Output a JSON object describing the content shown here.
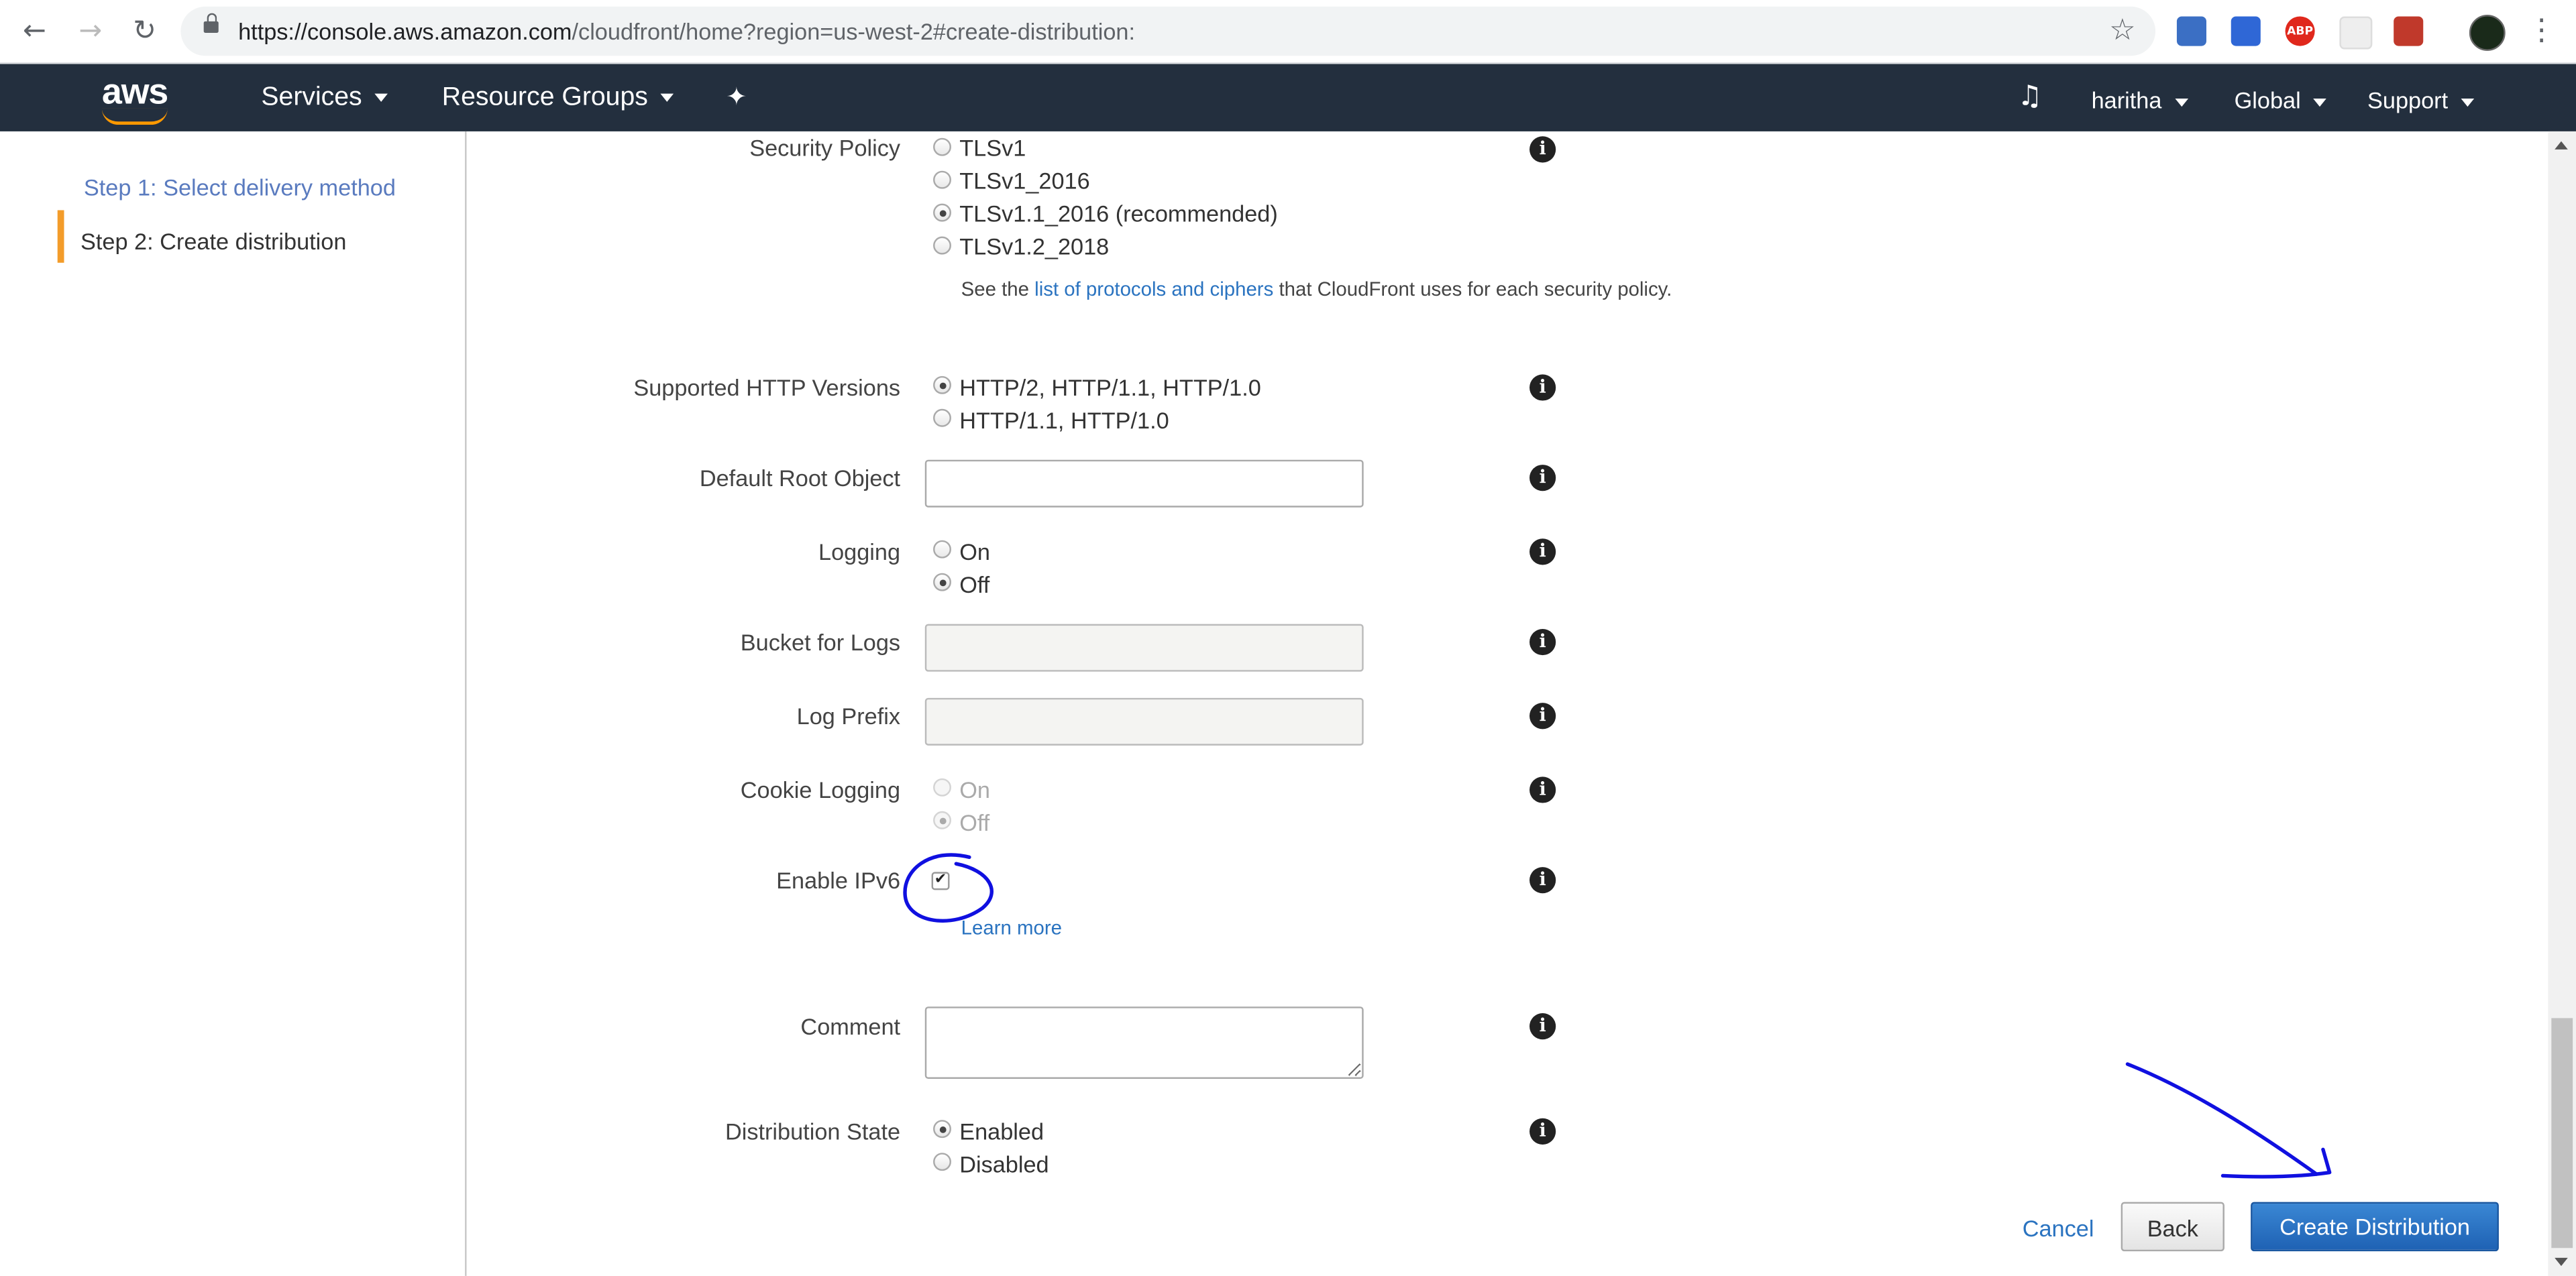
{
  "browser": {
    "url_host": "https://console.aws.amazon.com",
    "url_path": "/cloudfront/home?region=us-west-2#create-distribution:",
    "abp_label": "ABP"
  },
  "header": {
    "logo": "aws",
    "services": "Services",
    "resource_groups": "Resource Groups",
    "user": "haritha",
    "region": "Global",
    "support": "Support"
  },
  "sidebar": {
    "steps": [
      {
        "label": "Step 1: Select delivery method"
      },
      {
        "label": "Step 2: Create distribution"
      }
    ]
  },
  "form": {
    "security_policy": {
      "label": "Security Policy",
      "options": [
        "TLSv1",
        "TLSv1_2016",
        "TLSv1.1_2016 (recommended)",
        "TLSv1.2_2018"
      ],
      "selected": "TLSv1.1_2016 (recommended)",
      "help_prefix": "See the",
      "help_link": "list of protocols and ciphers",
      "help_suffix": "that CloudFront uses for each security policy."
    },
    "http_versions": {
      "label": "Supported HTTP Versions",
      "options": [
        "HTTP/2, HTTP/1.1, HTTP/1.0",
        "HTTP/1.1, HTTP/1.0"
      ],
      "selected": "HTTP/2, HTTP/1.1, HTTP/1.0"
    },
    "default_root_object": {
      "label": "Default Root Object",
      "value": ""
    },
    "logging": {
      "label": "Logging",
      "options": [
        "On",
        "Off"
      ],
      "selected": "Off"
    },
    "bucket_for_logs": {
      "label": "Bucket for Logs",
      "value": ""
    },
    "log_prefix": {
      "label": "Log Prefix",
      "value": ""
    },
    "cookie_logging": {
      "label": "Cookie Logging",
      "options": [
        "On",
        "Off"
      ],
      "selected": "Off",
      "disabled": true
    },
    "enable_ipv6": {
      "label": "Enable IPv6",
      "checked": true,
      "learn_more": "Learn more"
    },
    "comment": {
      "label": "Comment",
      "value": ""
    },
    "distribution_state": {
      "label": "Distribution State",
      "options": [
        "Enabled",
        "Disabled"
      ],
      "selected": "Enabled"
    }
  },
  "footer": {
    "cancel": "Cancel",
    "back": "Back",
    "create": "Create Distribution"
  },
  "icons": {
    "info": "info-icon",
    "back": "back-arrow-icon",
    "forward": "forward-arrow-icon",
    "reload": "reload-icon",
    "star": "star-icon",
    "bell": "bell-icon",
    "pin": "pin-icon"
  },
  "colors": {
    "aws_header": "#232f3e",
    "aws_orange": "#ff9900",
    "primary_button": "#1f62b4",
    "link": "#2a73c0",
    "annotation": "#1010e0"
  }
}
